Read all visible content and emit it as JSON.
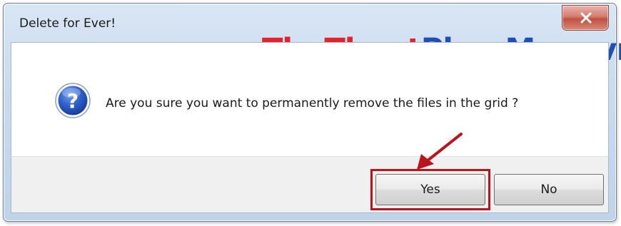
{
  "window": {
    "title": "Delete for Ever!",
    "close_glyph": "x"
  },
  "watermark": {
    "part1": "ThuThuat",
    "part2": "PhanMem.vn",
    "colors": {
      "part1": "#e8202a",
      "part2": "#1f4fb5"
    }
  },
  "message": {
    "icon": "question-icon",
    "text": "Are you sure you want to permanently remove the files in the grid ?"
  },
  "buttons": {
    "yes_label": "Yes",
    "no_label": "No"
  },
  "annotation": {
    "highlight_color": "#b8151c",
    "highlighted_button": "Yes"
  }
}
